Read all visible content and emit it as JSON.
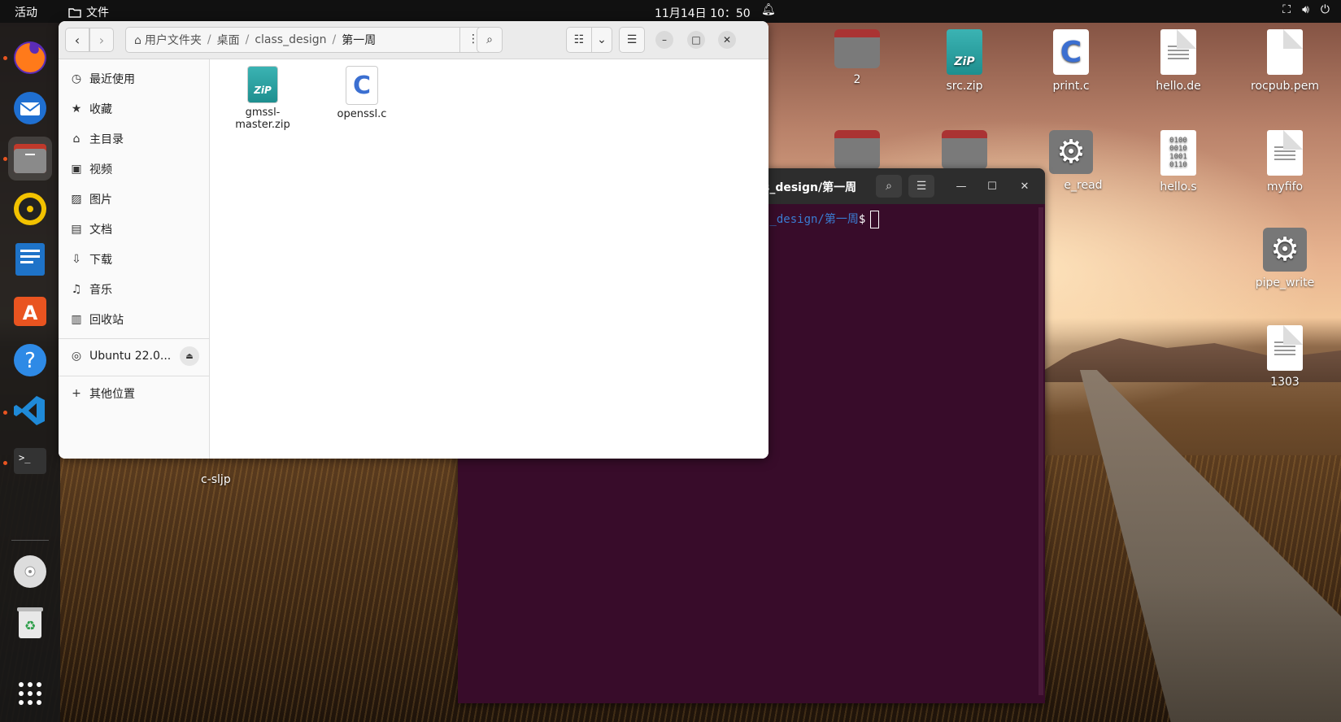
{
  "topbar": {
    "activities": "活动",
    "app_menu": "文件",
    "clock": "11月14日  10：50",
    "bell_icon": "bell-icon",
    "tray_icons": [
      "network-icon",
      "volume-icon",
      "power-icon"
    ]
  },
  "dock": {
    "items": [
      {
        "name": "firefox",
        "icon": "firefox-icon",
        "running": true
      },
      {
        "name": "thunderbird",
        "icon": "mail-icon",
        "running": false
      },
      {
        "name": "files",
        "icon": "files-icon",
        "running": true,
        "active": true
      },
      {
        "name": "rhythmbox",
        "icon": "music-icon",
        "running": false
      },
      {
        "name": "writer",
        "icon": "writer-icon",
        "running": false
      },
      {
        "name": "software",
        "icon": "software-icon",
        "running": false
      },
      {
        "name": "help",
        "icon": "help-icon",
        "running": false
      },
      {
        "name": "vscode",
        "icon": "vscode-icon",
        "running": true
      },
      {
        "name": "terminal",
        "icon": "terminal-icon",
        "running": true
      },
      {
        "name": "dvd",
        "icon": "disc-icon",
        "running": false
      },
      {
        "name": "trash",
        "icon": "trash-icon",
        "running": false
      },
      {
        "name": "apps",
        "icon": "app-grid-icon",
        "running": false
      }
    ]
  },
  "desktop": {
    "icons": [
      {
        "label": "2",
        "kind": "folder"
      },
      {
        "label": "src.zip",
        "kind": "zip"
      },
      {
        "label": "print.c",
        "kind": "c"
      },
      {
        "label": "hello.de",
        "kind": "doc"
      },
      {
        "label": "rocpub.pem",
        "kind": "doc"
      },
      {
        "label": "",
        "kind": "folder"
      },
      {
        "label": "",
        "kind": "home-folder"
      },
      {
        "label": "e_read",
        "kind": "gear"
      },
      {
        "label": "hello.s",
        "kind": "binary"
      },
      {
        "label": "myfifo",
        "kind": "doc"
      },
      {
        "label": "pipe_write",
        "kind": "gear"
      },
      {
        "label": "1303",
        "kind": "doc"
      }
    ],
    "stray_label": "c-sljp"
  },
  "terminal": {
    "title": "s_design/第一周",
    "prompt_path": "s_design/第一周",
    "prompt_symbol": "$"
  },
  "files": {
    "path": [
      "用户文件夹",
      "桌面",
      "class_design",
      "第一周"
    ],
    "separator": "/",
    "sidebar": [
      {
        "label": "最近使用",
        "icon": "clock-icon",
        "glyph": "◷"
      },
      {
        "label": "收藏",
        "icon": "star-icon",
        "glyph": "★"
      },
      {
        "label": "主目录",
        "icon": "home-icon",
        "glyph": "⌂"
      },
      {
        "label": "视频",
        "icon": "video-icon",
        "glyph": "▣"
      },
      {
        "label": "图片",
        "icon": "image-icon",
        "glyph": "▨"
      },
      {
        "label": "文档",
        "icon": "document-icon",
        "glyph": "▤"
      },
      {
        "label": "下载",
        "icon": "download-icon",
        "glyph": "⇩"
      },
      {
        "label": "音乐",
        "icon": "music-note-icon",
        "glyph": "♫"
      },
      {
        "label": "回收站",
        "icon": "trash-icon",
        "glyph": "▥"
      }
    ],
    "device": {
      "label": "Ubuntu 22.0...",
      "icon": "disc-icon"
    },
    "other_locations": "其他位置",
    "items": [
      {
        "name": "gmssl-\nmaster.zip",
        "kind": "zip"
      },
      {
        "name": "openssl.c",
        "kind": "c"
      }
    ]
  }
}
